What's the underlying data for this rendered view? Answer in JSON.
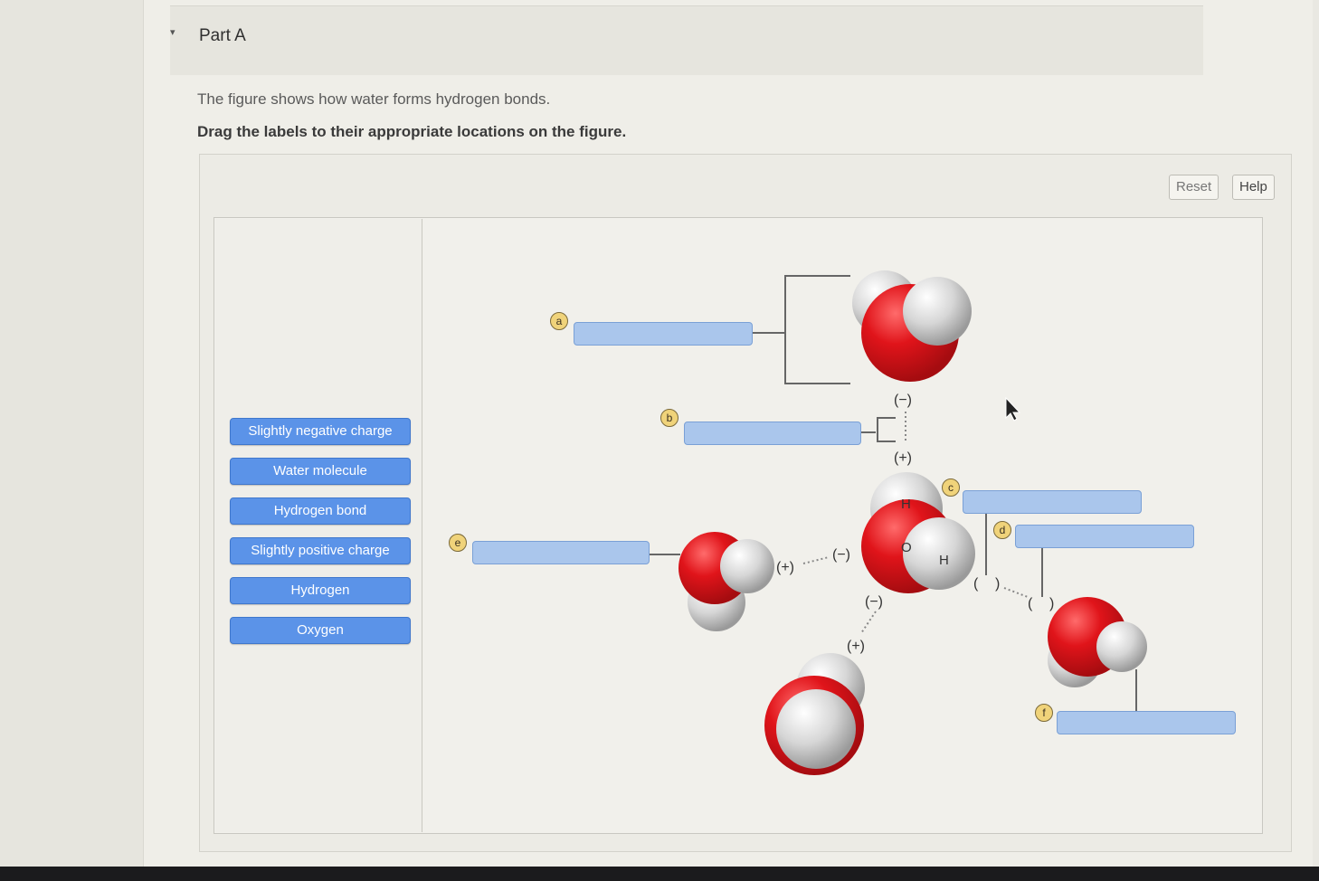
{
  "part": {
    "toggle": "▾",
    "title": "Part A"
  },
  "intro": "The figure shows how water forms hydrogen bonds.",
  "instruction": "Drag the labels to their appropriate locations on the figure.",
  "toolbar": {
    "reset_label": "Reset",
    "help_label": "Help"
  },
  "labels": [
    "Slightly negative charge",
    "Water molecule",
    "Hydrogen bond",
    "Slightly positive charge",
    "Hydrogen",
    "Oxygen"
  ],
  "markers": {
    "a": "a",
    "b": "b",
    "c": "c",
    "d": "d",
    "e": "e",
    "f": "f"
  },
  "figure": {
    "atoms": {
      "hydrogen": "H",
      "oxygen": "O"
    },
    "charges": {
      "neg": "(−)",
      "pos": "(+)",
      "blank_open": "(",
      "blank_close": ")"
    }
  },
  "colors": {
    "oxygen": "#e0141a",
    "hydrogen": "#d8d8d8",
    "label_bg": "#5b93e8",
    "target_bg": "#aac6ec"
  }
}
